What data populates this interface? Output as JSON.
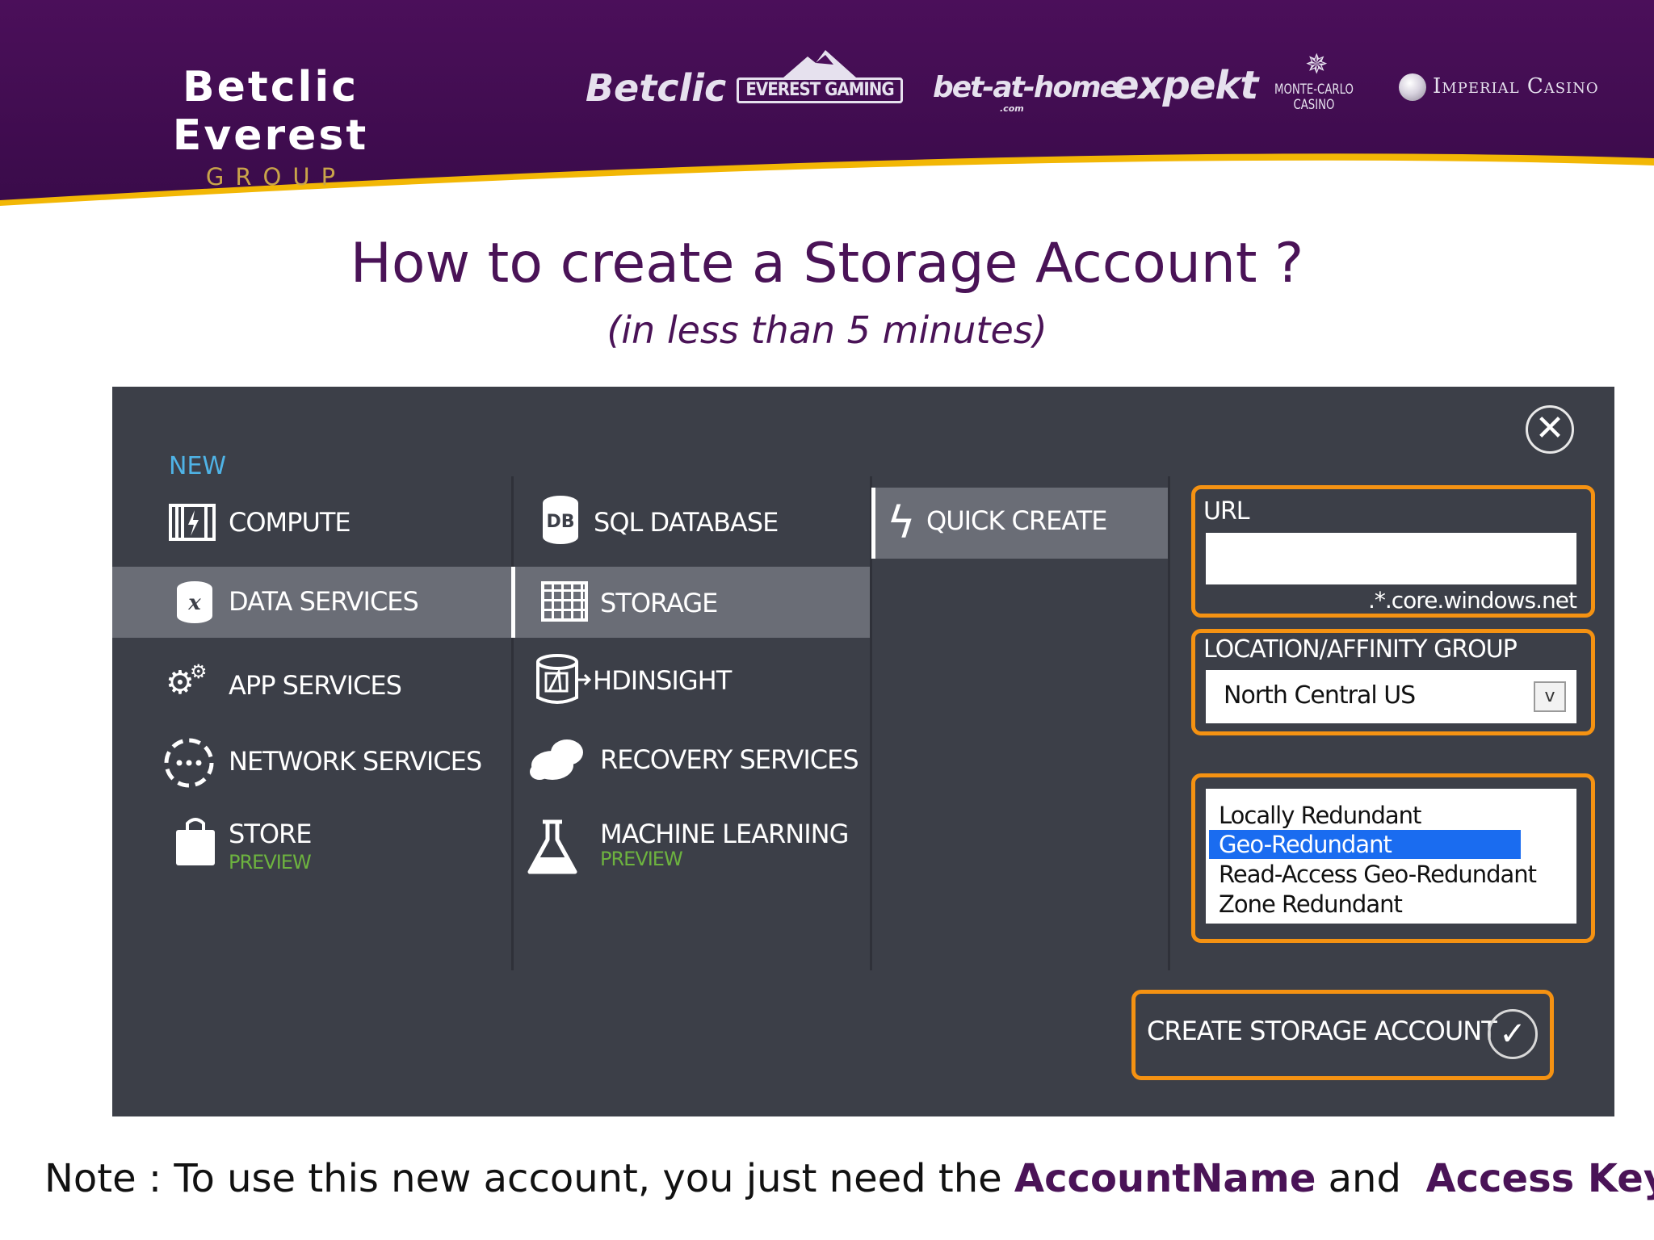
{
  "banner": {
    "brand_name": "Betclic Everest",
    "brand_sub": "GROUP",
    "logos": {
      "betclic": "Betclic",
      "everest": "EVEREST GAMING",
      "bet_at_home": "bet-at-home",
      "bet_at_home_com": ".com",
      "expekt": "expekt",
      "monte_carlo": "MONTE-CARLO",
      "casino": "CASINO",
      "imperial": "Imperial Casino"
    },
    "colors": {
      "purple": "#4a1357",
      "gold": "#f2b705"
    }
  },
  "slide": {
    "title": "How to create a Storage Account ?",
    "subtitle": "(in less than 5 minutes)"
  },
  "portal": {
    "new_label": "NEW",
    "close_glyph": "✕",
    "categories": [
      {
        "label": "COMPUTE",
        "icon": "compute-icon"
      },
      {
        "label": "DATA SERVICES",
        "icon": "data-services-icon",
        "selected": true
      },
      {
        "label": "APP SERVICES",
        "icon": "app-services-icon"
      },
      {
        "label": "NETWORK SERVICES",
        "icon": "network-services-icon"
      },
      {
        "label": "STORE",
        "sub": "PREVIEW",
        "icon": "store-icon"
      }
    ],
    "services": [
      {
        "label": "SQL DATABASE",
        "icon": "sql-database-icon",
        "icon_text": "DB"
      },
      {
        "label": "STORAGE",
        "icon": "storage-icon",
        "selected": true
      },
      {
        "label": "HDINSIGHT",
        "icon": "hdinsight-icon"
      },
      {
        "label": "RECOVERY SERVICES",
        "icon": "recovery-services-icon"
      },
      {
        "label": "MACHINE LEARNING",
        "sub": "PREVIEW",
        "icon": "machine-learning-icon"
      }
    ],
    "quick_create": {
      "label": "QUICK CREATE",
      "icon": "lightning-icon"
    },
    "form": {
      "url_label": "URL",
      "url_value": "",
      "url_suffix": ".*.core.windows.net",
      "location_label": "LOCATION/AFFINITY GROUP",
      "location_value": "North Central US",
      "replication_options": [
        "Locally Redundant",
        "Geo-Redundant",
        "Read-Access Geo-Redundant",
        "Zone Redundant"
      ],
      "replication_selected": "Geo-Redundant"
    },
    "create_button": {
      "label": "CREATE STORAGE ACCOUNT",
      "glyph": "✓"
    },
    "colors": {
      "panel": "#3c3f48",
      "selected": "#6a6d76",
      "highlight": "#f59212",
      "new": "#4fb3e6",
      "preview": "#6db33f",
      "listbox_selection": "#1a6cf0"
    }
  },
  "note": {
    "prefix": "Note : To use this new account, you just need the ",
    "account_name": "AccountName",
    "middle": " and  ",
    "access_keys": "Access Keys"
  }
}
